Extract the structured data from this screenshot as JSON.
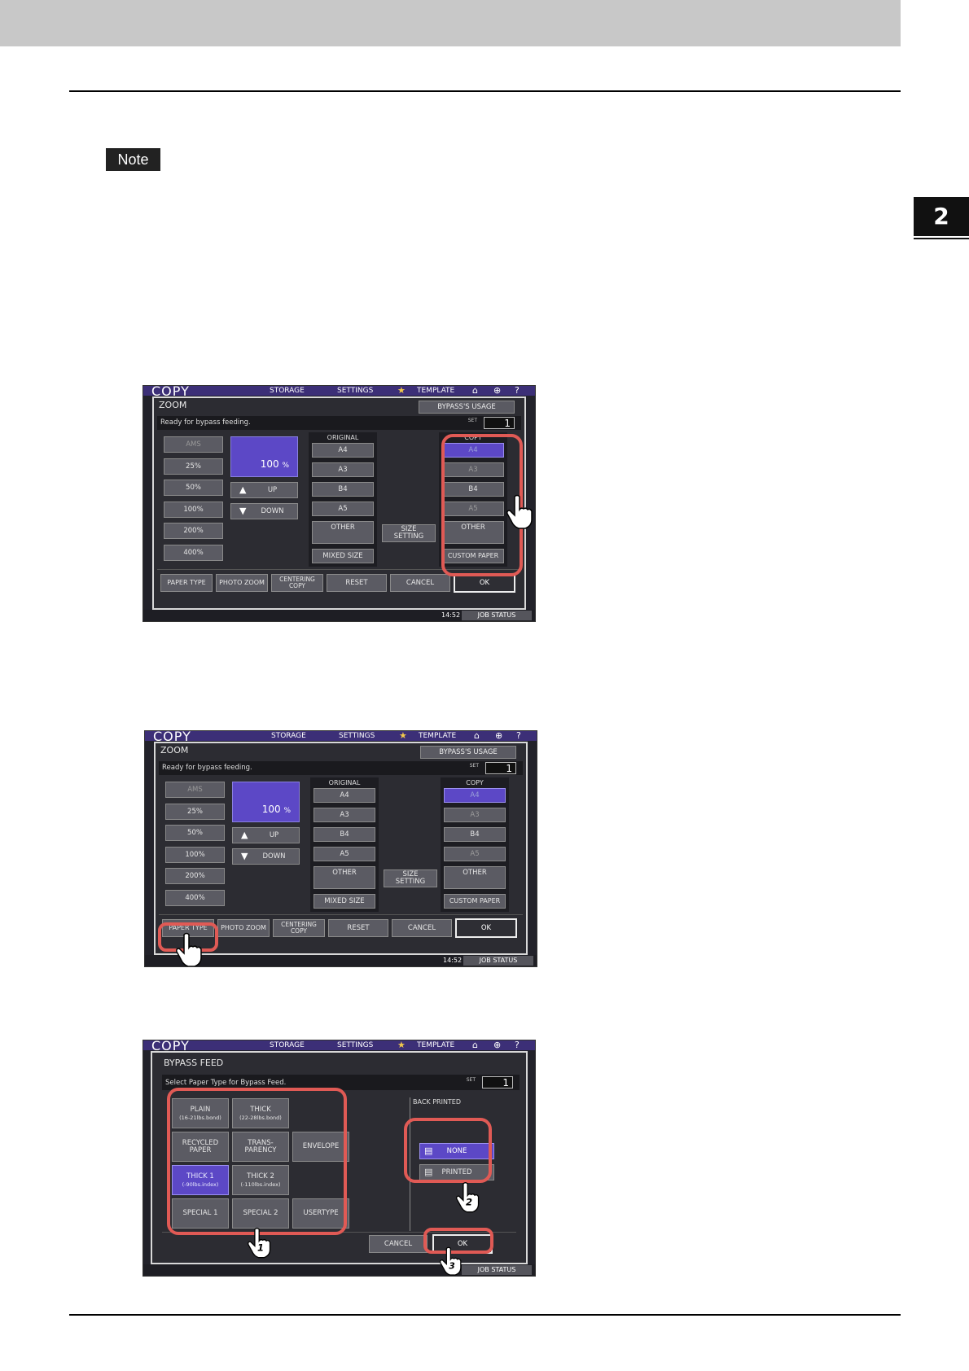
{
  "page": {
    "note_label": "Note",
    "chapter": "2"
  },
  "screen_common": {
    "app_title": "COPY",
    "storage": "STORAGE",
    "settings": "SETTINGS",
    "template": "TEMPLATE",
    "time": "14:52",
    "job_status": "JOB STATUS"
  },
  "zoom": {
    "title": "ZOOM",
    "bypass_usage": "BYPASS'S USAGE",
    "message": "Ready for bypass feeding.",
    "set_label": "SET",
    "set_value": "1",
    "ratio_buttons": [
      "AMS",
      "25%",
      "50%",
      "100%",
      "200%",
      "400%"
    ],
    "zoom_value": "100",
    "zoom_unit": "%",
    "up": "UP",
    "down": "DOWN",
    "original_label": "ORIGINAL",
    "original_buttons": [
      "A4",
      "A3",
      "B4",
      "A5",
      "OTHER",
      "MIXED SIZE"
    ],
    "size_setting_1": "SIZE",
    "size_setting_2": "SETTING",
    "copy_label": "COPY",
    "copy_buttons": [
      "A4",
      "A3",
      "B4",
      "A5",
      "OTHER",
      "CUSTOM PAPER"
    ],
    "paper_type": "PAPER TYPE",
    "photo_zoom": "PHOTO ZOOM",
    "centering_1": "CENTERING",
    "centering_2": "COPY",
    "reset": "RESET",
    "cancel": "CANCEL",
    "ok": "OK"
  },
  "bypass_feed": {
    "title": "BYPASS FEED",
    "message": "Select Paper Type for Bypass Feed.",
    "set_label": "SET",
    "set_value": "1",
    "plain": "PLAIN",
    "plain_sub": "(16-21lbs.bond)",
    "thick": "THICK",
    "thick_sub": "(22-28lbs.bond)",
    "recycled_1": "RECYCLED",
    "recycled_2": "PAPER",
    "trans_1": "TRANS-",
    "trans_2": "PARENCY",
    "envelope": "ENVELOPE",
    "thick1": "THICK 1",
    "thick1_sub": "(-90lbs.index)",
    "thick2": "THICK 2",
    "thick2_sub": "(-110lbs.index)",
    "special1": "SPECIAL 1",
    "special2": "SPECIAL 2",
    "usertype": "USERTYPE",
    "back_printed": "BACK PRINTED",
    "none": "NONE",
    "printed": "PRINTED",
    "cancel": "CANCEL",
    "ok": "OK",
    "step_1": "1",
    "step_2": "2",
    "step_3": "3"
  }
}
